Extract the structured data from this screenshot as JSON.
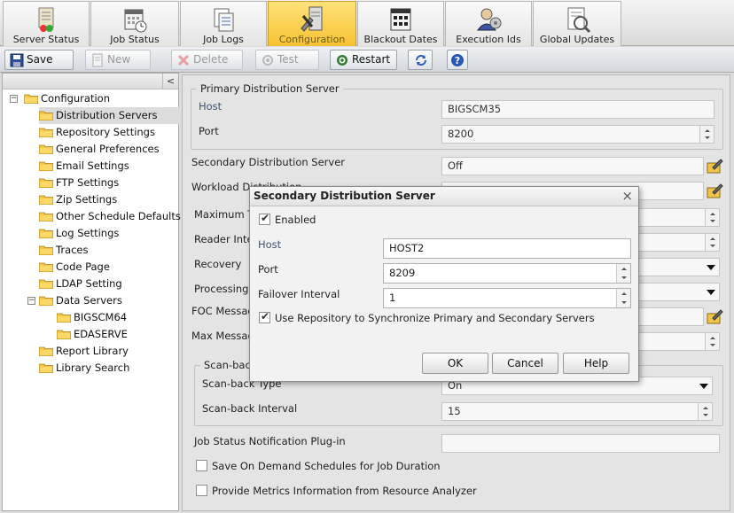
{
  "ribbon": {
    "tabs": [
      {
        "label": "Server Status",
        "icon": "server-status-icon"
      },
      {
        "label": "Job Status",
        "icon": "job-status-icon"
      },
      {
        "label": "Job Logs",
        "icon": "job-logs-icon"
      },
      {
        "label": "Configuration",
        "icon": "configuration-icon",
        "active": true
      },
      {
        "label": "Blackout Dates",
        "icon": "blackout-dates-icon"
      },
      {
        "label": "Execution Ids",
        "icon": "execution-ids-icon"
      },
      {
        "label": "Global Updates",
        "icon": "global-updates-icon"
      }
    ]
  },
  "toolbar": {
    "save_label": "Save",
    "new_label": "New",
    "delete_label": "Delete",
    "test_label": "Test",
    "restart_label": "Restart"
  },
  "tree": {
    "collapse_glyph": "<",
    "root": "Configuration",
    "items": [
      "Distribution Servers",
      "Repository Settings",
      "General Preferences",
      "Email Settings",
      "FTP Settings",
      "Zip Settings",
      "Other Schedule Defaults",
      "Log Settings",
      "Traces",
      "Code Page",
      "LDAP Setting",
      "Data Servers"
    ],
    "data_servers": [
      "BIGSCM64",
      "EDASERVE"
    ],
    "tail": [
      "Report Library",
      "Library Search"
    ]
  },
  "main": {
    "primary_group": "Primary Distribution Server",
    "host_label": "Host",
    "host_value": "BIGSCM35",
    "port_label": "Port",
    "port_value": "8200",
    "secondary_label": "Secondary Distribution Server",
    "secondary_value": "Off",
    "workload_label": "Workload Distribution",
    "max_threads_label": "Maximum Thr",
    "reader_label": "Reader Inter",
    "recovery_label": "Recovery",
    "processing_label": "Processing fo",
    "foc_label": "FOC Message",
    "max_message_label": "Max Message",
    "scanback_group": "Scan-back",
    "scanback_type_label": "Scan-back Type",
    "scanback_type_value": "On",
    "scanback_interval_label": "Scan-back Interval",
    "scanback_interval_value": "15",
    "job_status_plugin_label": "Job Status Notification Plug-in",
    "job_status_plugin_value": "",
    "save_on_demand_label": "Save On Demand Schedules for Job Duration",
    "provide_metrics_label": "Provide Metrics Information from Resource Analyzer"
  },
  "dialog": {
    "title": "Secondary Distribution Server",
    "close_glyph": "×",
    "enabled_label": "Enabled",
    "enabled_checked": true,
    "host_label": "Host",
    "host_value": "HOST2",
    "port_label": "Port",
    "port_value": "8209",
    "failover_label": "Failover Interval",
    "failover_value": "1",
    "use_repo_label": "Use Repository to Synchronize Primary and Secondary Servers",
    "use_repo_checked": true,
    "ok_label": "OK",
    "cancel_label": "Cancel",
    "help_label": "Help"
  },
  "colors": {
    "active_tab": "#f6c233",
    "panel_bg": "#e4e4e4",
    "selected_row": "#dcdcdc"
  }
}
